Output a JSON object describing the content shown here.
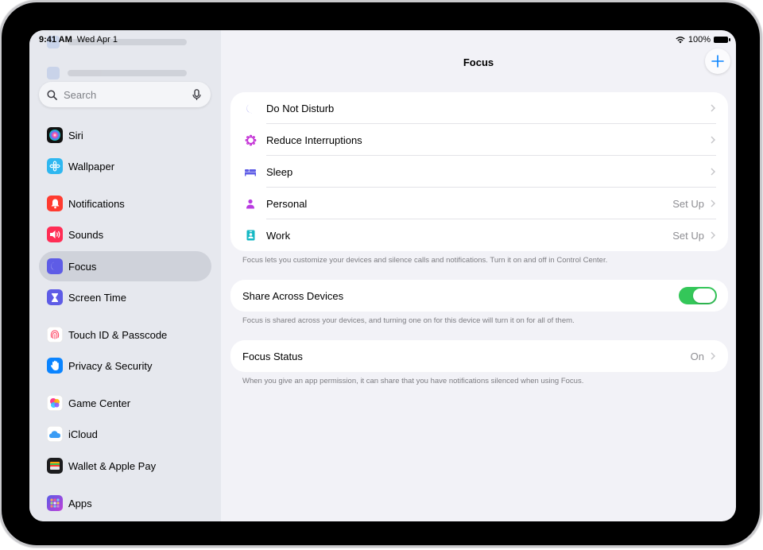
{
  "status_bar": {
    "time": "9:41 AM",
    "date": "Wed Apr 1",
    "battery": "100%"
  },
  "sidebar": {
    "search_placeholder": "Search",
    "items": [
      {
        "label": "Siri",
        "icon": "siri-icon",
        "color": "#6b3fd9"
      },
      {
        "label": "Wallpaper",
        "icon": "wallpaper-icon",
        "color": "#2fb7f0"
      },
      {
        "label": "Notifications",
        "icon": "bell-icon",
        "color": "#ff3b30"
      },
      {
        "label": "Sounds",
        "icon": "speaker-icon",
        "color": "#ff2d55"
      },
      {
        "label": "Focus",
        "icon": "moon-icon",
        "color": "#5e5ce6",
        "selected": true
      },
      {
        "label": "Screen Time",
        "icon": "hourglass-icon",
        "color": "#5e5ce6"
      },
      {
        "label": "Touch ID & Passcode",
        "icon": "fingerprint-icon",
        "color": "#ffffff"
      },
      {
        "label": "Privacy & Security",
        "icon": "hand-icon",
        "color": "#0a84ff"
      },
      {
        "label": "Game Center",
        "icon": "game-center-icon",
        "color": "#ffffff"
      },
      {
        "label": "iCloud",
        "icon": "cloud-icon",
        "color": "#ffffff"
      },
      {
        "label": "Wallet & Apple Pay",
        "icon": "wallet-icon",
        "color": "#1c1c1e"
      },
      {
        "label": "Apps",
        "icon": "apps-icon",
        "color": "#7a4dd8"
      }
    ]
  },
  "main": {
    "title": "Focus",
    "focus_modes": [
      {
        "label": "Do Not Disturb",
        "value": "",
        "icon": "moon-icon",
        "color": "#5e5ce6"
      },
      {
        "label": "Reduce Interruptions",
        "value": "",
        "icon": "reduce-interruptions-icon",
        "color": "#c026d3"
      },
      {
        "label": "Sleep",
        "value": "",
        "icon": "bed-icon",
        "color": "#5e5ce6"
      },
      {
        "label": "Personal",
        "value": "Set Up",
        "icon": "person-icon",
        "color": "#b83be0"
      },
      {
        "label": "Work",
        "value": "Set Up",
        "icon": "work-badge-icon",
        "color": "#14b8c4"
      }
    ],
    "focus_footnote": "Focus lets you customize your devices and silence calls and notifications. Turn it on and off in Control Center.",
    "share": {
      "label": "Share Across Devices",
      "enabled": true,
      "color": "#34c759"
    },
    "share_footnote": "Focus is shared across your devices, and turning one on for this device will turn it on for all of them.",
    "status": {
      "label": "Focus Status",
      "value": "On"
    },
    "status_footnote": "When you give an app permission, it can share that you have notifications silenced when using Focus."
  }
}
